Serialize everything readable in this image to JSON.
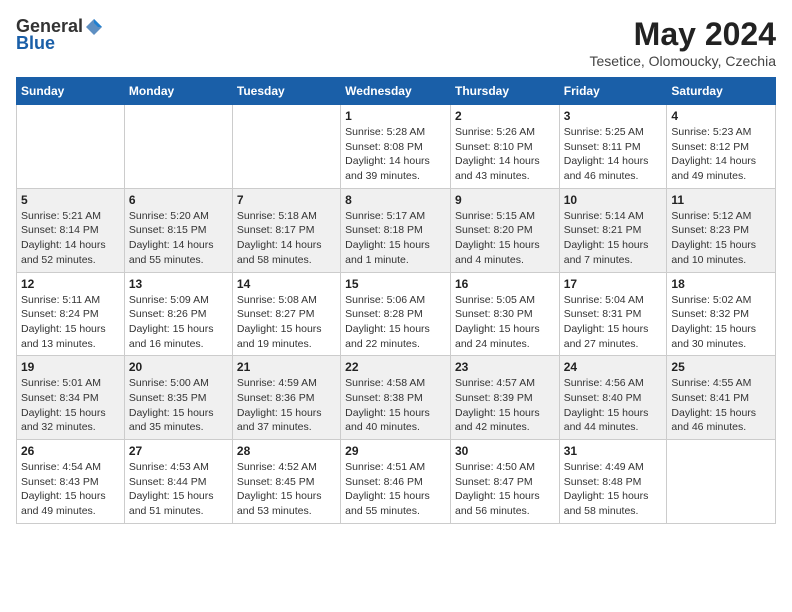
{
  "header": {
    "logo_general": "General",
    "logo_blue": "Blue",
    "month_year": "May 2024",
    "location": "Tesetice, Olomoucky, Czechia"
  },
  "days_of_week": [
    "Sunday",
    "Monday",
    "Tuesday",
    "Wednesday",
    "Thursday",
    "Friday",
    "Saturday"
  ],
  "weeks": [
    [
      {
        "day": "",
        "info": ""
      },
      {
        "day": "",
        "info": ""
      },
      {
        "day": "",
        "info": ""
      },
      {
        "day": "1",
        "info": "Sunrise: 5:28 AM\nSunset: 8:08 PM\nDaylight: 14 hours\nand 39 minutes."
      },
      {
        "day": "2",
        "info": "Sunrise: 5:26 AM\nSunset: 8:10 PM\nDaylight: 14 hours\nand 43 minutes."
      },
      {
        "day": "3",
        "info": "Sunrise: 5:25 AM\nSunset: 8:11 PM\nDaylight: 14 hours\nand 46 minutes."
      },
      {
        "day": "4",
        "info": "Sunrise: 5:23 AM\nSunset: 8:12 PM\nDaylight: 14 hours\nand 49 minutes."
      }
    ],
    [
      {
        "day": "5",
        "info": "Sunrise: 5:21 AM\nSunset: 8:14 PM\nDaylight: 14 hours\nand 52 minutes."
      },
      {
        "day": "6",
        "info": "Sunrise: 5:20 AM\nSunset: 8:15 PM\nDaylight: 14 hours\nand 55 minutes."
      },
      {
        "day": "7",
        "info": "Sunrise: 5:18 AM\nSunset: 8:17 PM\nDaylight: 14 hours\nand 58 minutes."
      },
      {
        "day": "8",
        "info": "Sunrise: 5:17 AM\nSunset: 8:18 PM\nDaylight: 15 hours\nand 1 minute."
      },
      {
        "day": "9",
        "info": "Sunrise: 5:15 AM\nSunset: 8:20 PM\nDaylight: 15 hours\nand 4 minutes."
      },
      {
        "day": "10",
        "info": "Sunrise: 5:14 AM\nSunset: 8:21 PM\nDaylight: 15 hours\nand 7 minutes."
      },
      {
        "day": "11",
        "info": "Sunrise: 5:12 AM\nSunset: 8:23 PM\nDaylight: 15 hours\nand 10 minutes."
      }
    ],
    [
      {
        "day": "12",
        "info": "Sunrise: 5:11 AM\nSunset: 8:24 PM\nDaylight: 15 hours\nand 13 minutes."
      },
      {
        "day": "13",
        "info": "Sunrise: 5:09 AM\nSunset: 8:26 PM\nDaylight: 15 hours\nand 16 minutes."
      },
      {
        "day": "14",
        "info": "Sunrise: 5:08 AM\nSunset: 8:27 PM\nDaylight: 15 hours\nand 19 minutes."
      },
      {
        "day": "15",
        "info": "Sunrise: 5:06 AM\nSunset: 8:28 PM\nDaylight: 15 hours\nand 22 minutes."
      },
      {
        "day": "16",
        "info": "Sunrise: 5:05 AM\nSunset: 8:30 PM\nDaylight: 15 hours\nand 24 minutes."
      },
      {
        "day": "17",
        "info": "Sunrise: 5:04 AM\nSunset: 8:31 PM\nDaylight: 15 hours\nand 27 minutes."
      },
      {
        "day": "18",
        "info": "Sunrise: 5:02 AM\nSunset: 8:32 PM\nDaylight: 15 hours\nand 30 minutes."
      }
    ],
    [
      {
        "day": "19",
        "info": "Sunrise: 5:01 AM\nSunset: 8:34 PM\nDaylight: 15 hours\nand 32 minutes."
      },
      {
        "day": "20",
        "info": "Sunrise: 5:00 AM\nSunset: 8:35 PM\nDaylight: 15 hours\nand 35 minutes."
      },
      {
        "day": "21",
        "info": "Sunrise: 4:59 AM\nSunset: 8:36 PM\nDaylight: 15 hours\nand 37 minutes."
      },
      {
        "day": "22",
        "info": "Sunrise: 4:58 AM\nSunset: 8:38 PM\nDaylight: 15 hours\nand 40 minutes."
      },
      {
        "day": "23",
        "info": "Sunrise: 4:57 AM\nSunset: 8:39 PM\nDaylight: 15 hours\nand 42 minutes."
      },
      {
        "day": "24",
        "info": "Sunrise: 4:56 AM\nSunset: 8:40 PM\nDaylight: 15 hours\nand 44 minutes."
      },
      {
        "day": "25",
        "info": "Sunrise: 4:55 AM\nSunset: 8:41 PM\nDaylight: 15 hours\nand 46 minutes."
      }
    ],
    [
      {
        "day": "26",
        "info": "Sunrise: 4:54 AM\nSunset: 8:43 PM\nDaylight: 15 hours\nand 49 minutes."
      },
      {
        "day": "27",
        "info": "Sunrise: 4:53 AM\nSunset: 8:44 PM\nDaylight: 15 hours\nand 51 minutes."
      },
      {
        "day": "28",
        "info": "Sunrise: 4:52 AM\nSunset: 8:45 PM\nDaylight: 15 hours\nand 53 minutes."
      },
      {
        "day": "29",
        "info": "Sunrise: 4:51 AM\nSunset: 8:46 PM\nDaylight: 15 hours\nand 55 minutes."
      },
      {
        "day": "30",
        "info": "Sunrise: 4:50 AM\nSunset: 8:47 PM\nDaylight: 15 hours\nand 56 minutes."
      },
      {
        "day": "31",
        "info": "Sunrise: 4:49 AM\nSunset: 8:48 PM\nDaylight: 15 hours\nand 58 minutes."
      },
      {
        "day": "",
        "info": ""
      }
    ]
  ]
}
